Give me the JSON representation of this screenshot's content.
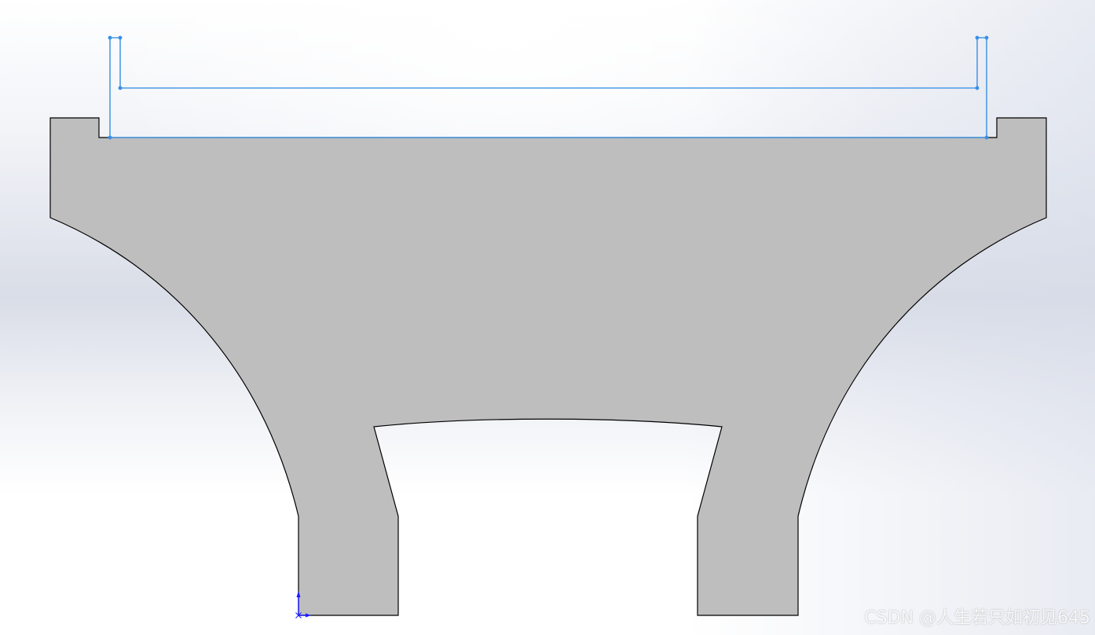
{
  "colors": {
    "part_fill": "#bebebe",
    "part_edge": "#000000",
    "sketch_line": "#4a9be8",
    "sketch_point": "#3a8ee6",
    "origin": "#1a1aff"
  },
  "watermark": {
    "text": "CSDN @人生若只如初见645"
  }
}
